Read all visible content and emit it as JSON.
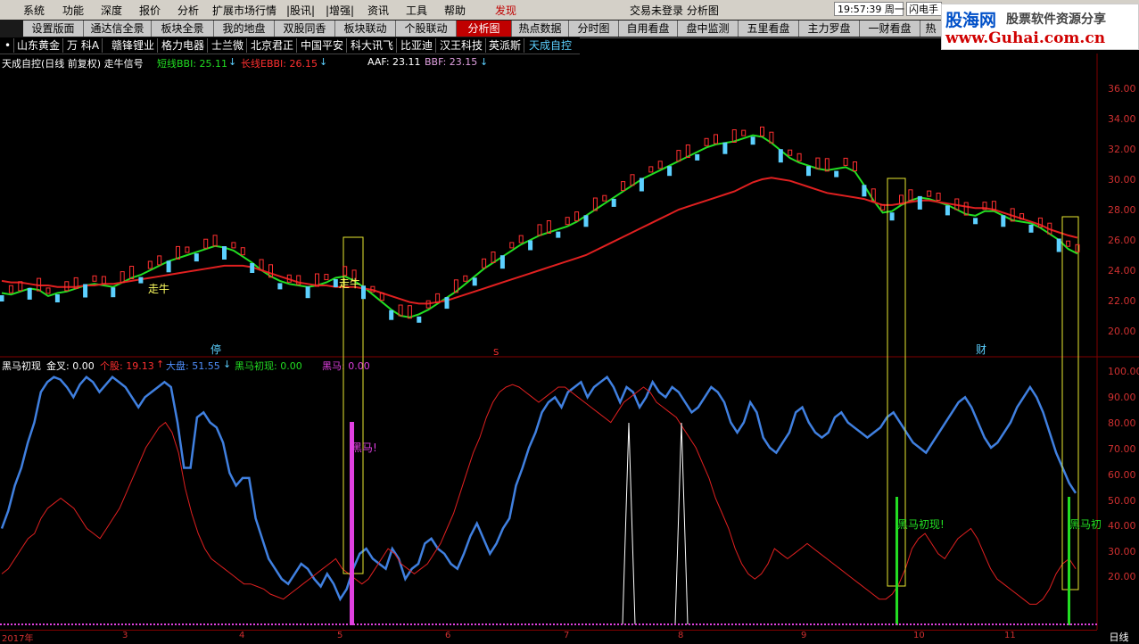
{
  "menubar": {
    "items": [
      "系统",
      "功能",
      "深度",
      "报价",
      "分析",
      "扩展市场行情",
      "|股讯|",
      "|增强|",
      "资讯",
      "工具",
      "帮助",
      "发现"
    ],
    "center_status": "交易未登录   分析图",
    "clock": "19:57:39 周一",
    "flash": "闪电手"
  },
  "logo": {
    "main": "股海网",
    "sub": "股票软件资源分享",
    "url": "www.Guhai.com.cn"
  },
  "tabs": [
    "设置版面",
    "通达信全景",
    "板块全景",
    "我的地盘",
    "双股同香",
    "板块联动",
    "个股联动",
    "分析图",
    "热点数据",
    "分时图",
    "自用看盘",
    "盘中监测",
    "五里看盘",
    "主力罗盘",
    "一财看盘",
    "热"
  ],
  "active_tab": "分析图",
  "stocks": [
    "•",
    "山东黄金",
    "万 科A",
    "赣锋锂业",
    "格力电器",
    "士兰微",
    "北京君正",
    "中国平安",
    "科大讯飞",
    "比亚迪",
    "汉王科技",
    "英派斯",
    "天成自控"
  ],
  "active_stock": "天成自控",
  "main_legend": {
    "title": "天成自控(日线 前复权) 走牛信号",
    "short_label": "短线BBI: 25.11",
    "long_label": "长线EBBI: 26.15",
    "aaf": "AAF: 23.11",
    "bbf": "BBF: 23.15",
    "arrow": "↓"
  },
  "sub_legend": {
    "title": "黑马初现",
    "gold": "金叉: 0.00",
    "stock_val": "个股: 19.13",
    "market_val": "大盘: 51.55",
    "hm_val": "黑马初现: 0.00",
    "hm2_val": "黑马: 0.00",
    "up": "↑",
    "down": "↓"
  },
  "price_axis": [
    "36.00",
    "34.00",
    "32.00",
    "30.00",
    "28.00",
    "26.00",
    "24.00",
    "22.00",
    "20.00"
  ],
  "pct_axis": [
    "100.00",
    "90.00",
    "80.00",
    "70.00",
    "60.00",
    "50.00",
    "40.00",
    "30.00",
    "20.00"
  ],
  "date_axis": [
    "2017年",
    "3",
    "4",
    "5",
    "6",
    "7",
    "8",
    "9",
    "10",
    "11"
  ],
  "period": "日线",
  "chart_marks": {
    "zou_niu_1": "走牛",
    "zou_niu_2": "走牛",
    "ting": "停",
    "cai": "财",
    "s_mark": "S",
    "heima": "黑马!",
    "heima_chuxian": "黑马初现!",
    "heima_chuxian_2": "黑马初"
  },
  "chart_data": {
    "type": "line",
    "price_ylim": [
      19.5,
      36.5
    ],
    "series": [
      {
        "values": [
          22.5,
          22.4,
          22.6,
          22.8,
          22.7,
          22.3,
          22.5,
          22.6,
          22.8,
          23.0,
          23.1,
          23.0,
          22.9,
          23.2,
          23.5,
          23.7,
          24.0,
          24.3,
          24.6,
          24.8,
          25.0,
          25.2,
          25.4,
          25.6,
          25.5,
          25.3,
          24.9,
          24.5,
          24.0,
          23.6,
          23.3,
          23.1,
          23.0,
          22.9,
          23.0,
          23.2,
          23.5,
          23.6,
          23.3,
          22.9,
          22.4,
          21.9,
          21.4,
          21.0,
          20.9,
          21.1,
          21.4,
          21.8,
          22.2,
          22.6,
          23.1,
          23.6,
          24.1,
          24.5,
          24.9,
          25.3,
          25.7,
          26.0,
          26.3,
          26.5,
          26.7,
          26.9,
          27.2,
          27.6,
          28.0,
          28.4,
          28.8,
          29.2,
          29.6,
          30.0,
          30.3,
          30.6,
          30.9,
          31.2,
          31.5,
          31.8,
          32.1,
          32.3,
          32.4,
          32.5,
          32.7,
          32.9,
          32.8,
          32.4,
          31.9,
          31.4,
          31.1,
          30.9,
          30.7,
          30.6,
          30.7,
          30.8,
          30.5,
          29.6,
          28.6,
          27.8,
          27.9,
          28.3,
          28.6,
          28.8,
          28.7,
          28.5,
          28.3,
          28.0,
          27.7,
          27.6,
          27.9,
          27.9,
          27.6,
          27.3,
          27.2,
          27.1,
          26.8,
          26.4,
          26.0,
          25.4,
          25.1
        ]
      },
      {
        "values": [
          23.3,
          23.2,
          23.2,
          23.1,
          23.0,
          23.0,
          22.9,
          22.9,
          22.9,
          23.0,
          23.0,
          23.1,
          23.1,
          23.2,
          23.3,
          23.4,
          23.5,
          23.6,
          23.7,
          23.8,
          23.9,
          24.0,
          24.1,
          24.2,
          24.3,
          24.3,
          24.3,
          24.2,
          24.0,
          23.8,
          23.6,
          23.4,
          23.2,
          23.1,
          23.0,
          23.0,
          22.9,
          22.9,
          22.9,
          22.8,
          22.7,
          22.5,
          22.3,
          22.1,
          21.9,
          21.8,
          21.8,
          21.9,
          22.0,
          22.2,
          22.4,
          22.6,
          22.8,
          23.0,
          23.2,
          23.4,
          23.6,
          23.8,
          24.0,
          24.2,
          24.4,
          24.6,
          24.8,
          25.0,
          25.3,
          25.6,
          25.9,
          26.2,
          26.5,
          26.8,
          27.1,
          27.4,
          27.7,
          28.0,
          28.2,
          28.4,
          28.6,
          28.8,
          29.0,
          29.2,
          29.5,
          29.8,
          30.0,
          30.1,
          30.0,
          29.9,
          29.7,
          29.5,
          29.3,
          29.1,
          29.0,
          28.9,
          28.8,
          28.7,
          28.5,
          28.3,
          28.3,
          28.4,
          28.5,
          28.6,
          28.6,
          28.5,
          28.4,
          28.3,
          28.2,
          28.1,
          28.1,
          28.0,
          27.8,
          27.6,
          27.4,
          27.2,
          27.0,
          26.7,
          26.5,
          26.3,
          26.15
        ]
      }
    ],
    "sub_ylim": [
      0,
      105
    ],
    "sub_series": [
      {
        "values": [
          38,
          45,
          55,
          62,
          72,
          80,
          92,
          96,
          98,
          97,
          94,
          90,
          95,
          98,
          96,
          92,
          95,
          98,
          96,
          94,
          90,
          86,
          90,
          92,
          94,
          96,
          94,
          80,
          62,
          62,
          82,
          84,
          80,
          78,
          72,
          60,
          55,
          58,
          58,
          42,
          34,
          26,
          22,
          18,
          16,
          20,
          24,
          22,
          18,
          15,
          20,
          16,
          10,
          14,
          22,
          28,
          30,
          26,
          24,
          22,
          30,
          26,
          18,
          22,
          24,
          32,
          34,
          30,
          28,
          24,
          22,
          28,
          35,
          40,
          34,
          28,
          32,
          38,
          42,
          55,
          62,
          70,
          76,
          84,
          88,
          90,
          86,
          92,
          94,
          96,
          90,
          94,
          96,
          98,
          94,
          88,
          94,
          92,
          86,
          90,
          96,
          92,
          90,
          94,
          92,
          88,
          84,
          86,
          90,
          94,
          92,
          88,
          80,
          76,
          80,
          88,
          84,
          74,
          70,
          68,
          72,
          76,
          84,
          86,
          80,
          76,
          74,
          76,
          82,
          84,
          80,
          78,
          76,
          74,
          76,
          78,
          82,
          84,
          80,
          76,
          72,
          70,
          68,
          72,
          76,
          80,
          84,
          88,
          90,
          86,
          80,
          74,
          70,
          72,
          76,
          80,
          86,
          90,
          94,
          90,
          84,
          76,
          68,
          62,
          56,
          52
        ]
      },
      {
        "values": [
          20,
          22,
          26,
          30,
          34,
          36,
          42,
          46,
          48,
          50,
          48,
          46,
          42,
          38,
          36,
          34,
          38,
          42,
          46,
          52,
          58,
          64,
          70,
          74,
          78,
          80,
          76,
          68,
          54,
          44,
          36,
          30,
          26,
          24,
          22,
          20,
          18,
          16,
          16,
          15,
          14,
          12,
          11,
          10,
          12,
          14,
          16,
          18,
          20,
          22,
          24,
          26,
          22,
          20,
          18,
          16,
          18,
          22,
          26,
          30,
          28,
          24,
          22,
          20,
          22,
          24,
          28,
          32,
          38,
          44,
          52,
          60,
          68,
          74,
          82,
          88,
          92,
          94,
          95,
          94,
          92,
          90,
          88,
          90,
          92,
          94,
          94,
          92,
          90,
          88,
          86,
          84,
          82,
          80,
          84,
          88,
          90,
          92,
          94,
          92,
          88,
          86,
          84,
          82,
          78,
          74,
          70,
          64,
          58,
          50,
          44,
          38,
          30,
          24,
          20,
          18,
          20,
          24,
          30,
          28,
          26,
          28,
          30,
          32,
          30,
          28,
          26,
          24,
          22,
          20,
          18,
          16,
          14,
          12,
          10,
          10,
          12,
          16,
          22,
          30,
          34,
          36,
          32,
          28,
          26,
          30,
          34,
          36,
          38,
          34,
          28,
          22,
          18,
          16,
          14,
          12,
          10,
          8,
          8,
          10,
          14,
          20,
          24,
          26,
          22
        ]
      }
    ]
  }
}
